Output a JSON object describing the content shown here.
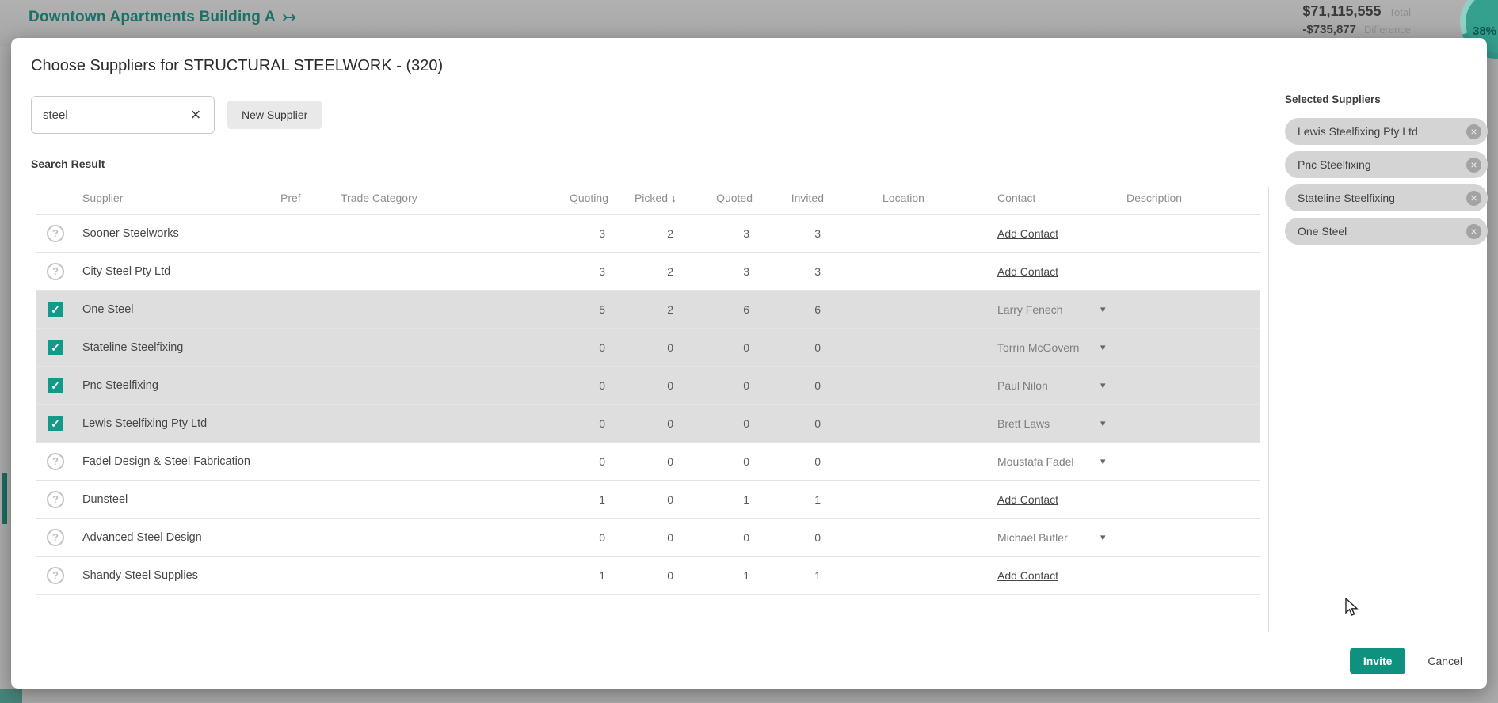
{
  "background": {
    "project_title": "Downtown Apartments Building A",
    "total_amount": "$71,115,555",
    "total_label": "Total",
    "difference_amount": "-$735,877",
    "difference_label": "Difference",
    "progress_badge": "38%"
  },
  "icons": {
    "title_arrow": "↣",
    "clear": "×",
    "sort_desc": "↓",
    "check": "✓",
    "unverified": "?",
    "dropdown_caret": "▾",
    "remove": "×"
  },
  "colors": {
    "accent_teal": "#0f9180",
    "checkbox_teal": "#12998a",
    "selected_row": "#dedede",
    "chip_gray": "#d4d4d4",
    "overlay_gray": "#ababab"
  },
  "modal": {
    "title": "Choose Suppliers for STRUCTURAL STEELWORK - (320)",
    "search": {
      "value": "steel",
      "placeholder": ""
    },
    "new_supplier_label": "New Supplier",
    "section_label": "Search Result",
    "table": {
      "headers": [
        "Supplier",
        "Pref",
        "Trade Category",
        "Quoting",
        "Picked",
        "Quoted",
        "Invited",
        "Location",
        "Contact",
        "Description"
      ],
      "sort_column": "Picked",
      "rows": [
        {
          "supplier": "Sooner Steelworks",
          "checked": false,
          "pref": "",
          "trade_category": "",
          "quoting": "3",
          "picked": "2",
          "quoted": "3",
          "invited": "3",
          "location": "",
          "contact": "Add Contact",
          "contact_type": "link",
          "description": ""
        },
        {
          "supplier": "City Steel Pty Ltd",
          "checked": false,
          "pref": "",
          "trade_category": "",
          "quoting": "3",
          "picked": "2",
          "quoted": "3",
          "invited": "3",
          "location": "",
          "contact": "Add Contact",
          "contact_type": "link",
          "description": ""
        },
        {
          "supplier": "One Steel",
          "checked": true,
          "pref": "",
          "trade_category": "",
          "quoting": "5",
          "picked": "2",
          "quoted": "6",
          "invited": "6",
          "location": "",
          "contact": "Larry Fenech",
          "contact_type": "dropdown",
          "description": ""
        },
        {
          "supplier": "Stateline Steelfixing",
          "checked": true,
          "pref": "",
          "trade_category": "",
          "quoting": "0",
          "picked": "0",
          "quoted": "0",
          "invited": "0",
          "location": "",
          "contact": "Torrin McGovern",
          "contact_type": "dropdown",
          "description": ""
        },
        {
          "supplier": "Pnc Steelfixing",
          "checked": true,
          "pref": "",
          "trade_category": "",
          "quoting": "0",
          "picked": "0",
          "quoted": "0",
          "invited": "0",
          "location": "",
          "contact": "Paul Nilon",
          "contact_type": "dropdown",
          "description": ""
        },
        {
          "supplier": "Lewis Steelfixing Pty Ltd",
          "checked": true,
          "pref": "",
          "trade_category": "",
          "quoting": "0",
          "picked": "0",
          "quoted": "0",
          "invited": "0",
          "location": "",
          "contact": "Brett Laws",
          "contact_type": "dropdown",
          "description": ""
        },
        {
          "supplier": "Fadel Design & Steel Fabrication",
          "checked": false,
          "pref": "",
          "trade_category": "",
          "quoting": "0",
          "picked": "0",
          "quoted": "0",
          "invited": "0",
          "location": "",
          "contact": "Moustafa Fadel",
          "contact_type": "dropdown",
          "description": ""
        },
        {
          "supplier": "Dunsteel",
          "checked": false,
          "pref": "",
          "trade_category": "",
          "quoting": "1",
          "picked": "0",
          "quoted": "1",
          "invited": "1",
          "location": "",
          "contact": "Add Contact",
          "contact_type": "link",
          "description": ""
        },
        {
          "supplier": "Advanced Steel Design",
          "checked": false,
          "pref": "",
          "trade_category": "",
          "quoting": "0",
          "picked": "0",
          "quoted": "0",
          "invited": "0",
          "location": "",
          "contact": "Michael Butler",
          "contact_type": "dropdown",
          "description": ""
        },
        {
          "supplier": "Shandy Steel Supplies",
          "checked": false,
          "pref": "",
          "trade_category": "",
          "quoting": "1",
          "picked": "0",
          "quoted": "1",
          "invited": "1",
          "location": "",
          "contact": "Add Contact",
          "contact_type": "link",
          "description": ""
        }
      ]
    },
    "selected_panel": {
      "title": "Selected Suppliers",
      "chips": [
        "Lewis Steelfixing Pty Ltd",
        "Pnc Steelfixing",
        "Stateline Steelfixing",
        "One Steel"
      ]
    },
    "footer": {
      "invite_label": "Invite",
      "cancel_label": "Cancel"
    }
  }
}
